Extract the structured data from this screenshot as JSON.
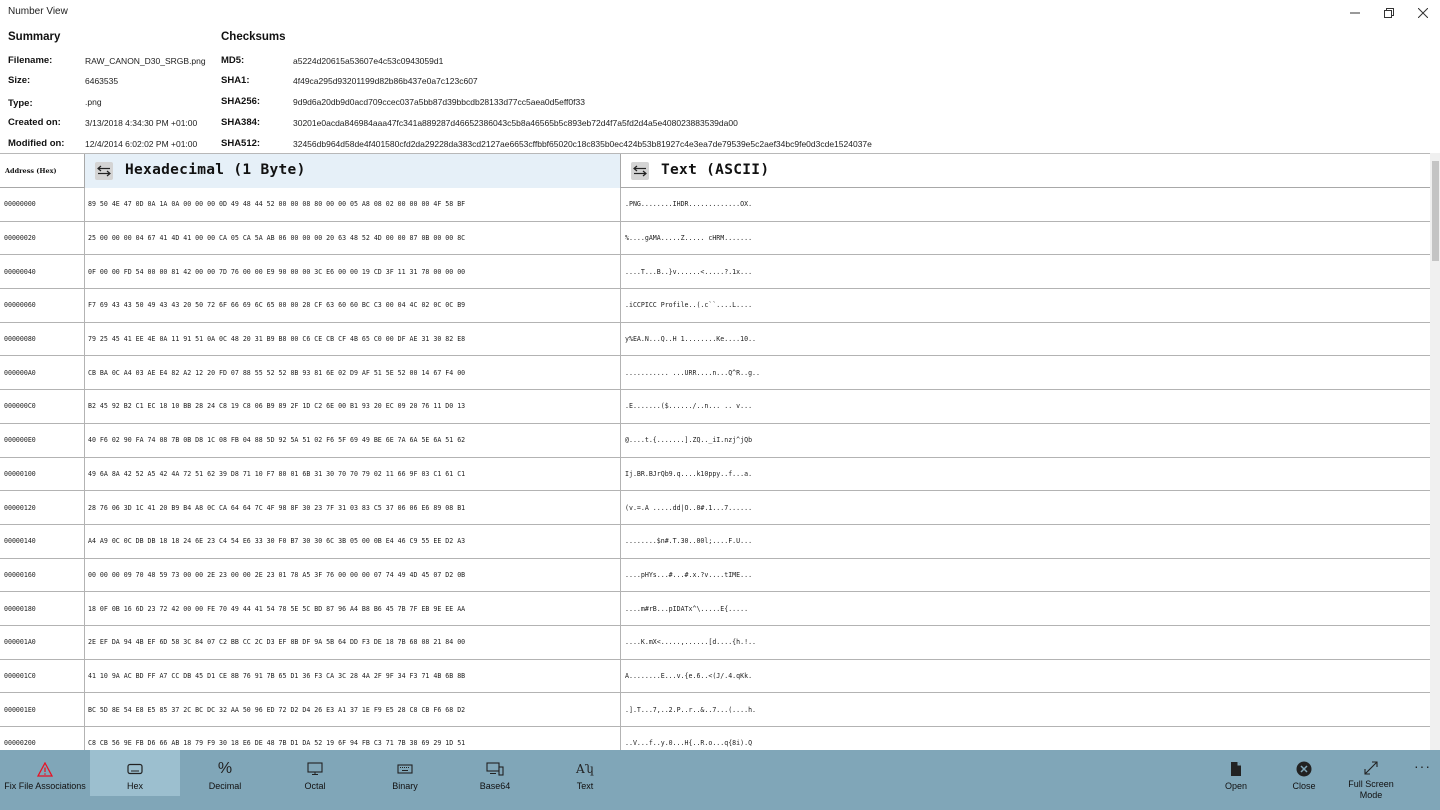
{
  "window": {
    "title": "Number View"
  },
  "summary": {
    "title": "Summary",
    "filename_label": "Filename:",
    "filename": "RAW_CANON_D30_SRGB.png",
    "size_label": "Size:",
    "size": "6463535",
    "type_label": "Type:",
    "type": ".png",
    "created_label": "Created on:",
    "created": "3/13/2018 4:34:30 PM +01:00",
    "modified_label": "Modified on:",
    "modified": "12/4/2014 6:02:02 PM +01:00"
  },
  "checksums": {
    "title": "Checksums",
    "md5_label": "MD5:",
    "md5": "a5224d20615a53607e4c53c0943059d1",
    "sha1_label": "SHA1:",
    "sha1": "4f49ca295d93201199d82b86b437e0a7c123c607",
    "sha256_label": "SHA256:",
    "sha256": "9d9d6a20db9d0acd709ccec037a5bb87d39bbcdb28133d77cc5aea0d5eff0f33",
    "sha384_label": "SHA384:",
    "sha384": "30201e0acda846984aaa47fc341a889287d46652386043c5b8a46565b5c893eb72d4f7a5fd2d4a5e408023883539da00",
    "sha512_label": "SHA512:",
    "sha512": "32456db964d58de4f401580cfd2da29228da383cd2127ae6653cffbbf65020c18c835b0ec424b53b81927c4e3ea7de79539e5c2aef34bc9fe0d3cde1524037e"
  },
  "grid": {
    "address_header": "Address (Hex)",
    "hex_header": "Hexadecimal (1 Byte)",
    "text_header": "Text (ASCII)",
    "rows": [
      {
        "addr": "00000000",
        "hex": "89 50 4E 47 0D 0A 1A 0A 00 00 00 0D 49 48 44 52 00 00 08 80 00 00 05 A8 08 02 00 00 00 4F 58 BF",
        "text": ".PNG........IHDR.............OX."
      },
      {
        "addr": "00000020",
        "hex": "25 00 00 00 04 67 41 4D 41 00 00 CA 05 CA 5A AB 06 00 00 00 20 63 48 52 4D 00 00 87 0B 00 00 8C",
        "text": "%....gAMA.....Z..... cHRM......."
      },
      {
        "addr": "00000040",
        "hex": "0F 00 00 FD 54 00 00 81 42 00 00 7D 76 00 00 E9 90 00 00 3C E6 00 00 19 CD 3F 11 31 78 00 00 00",
        "text": "....T...B..}v......<.....?.1x..."
      },
      {
        "addr": "00000060",
        "hex": "F7 69 43 43 50 49 43 43 20 50 72 6F 66 69 6C 65 00 00 28 CF 63 60 60 BC C3 00 04 4C 02 0C 0C B9",
        "text": ".iCCPICC Profile..(.c``....L...."
      },
      {
        "addr": "00000080",
        "hex": "79 25 45 41 EE 4E 0A 11 91 51 0A 0C 48 20 31 B9 B8 00 C6 CE CB CF 4B 65 C0 00 DF AE 31 30 82 E8",
        "text": "y%EA.N...Q..H 1........Ke....10.."
      },
      {
        "addr": "000000A0",
        "hex": "CB BA 0C A4 03 AE E4 82 A2 12 20 FD 07 88 55 52 52 8B 93 81 6E 02 D9 AF 51 5E 52 00 14 67 F4 00",
        "text": "........... ...URR....n...Q^R..g.."
      },
      {
        "addr": "000000C0",
        "hex": "B2 45 92 B2 C1 EC 18 10 BB 28 24 C8 19 C8 06 B9 89 2F 1D C2 6E 00 B1 93 20 EC 09 20 76 11 D0 13",
        "text": ".E.......($....../..n... .. v..."
      },
      {
        "addr": "000000E0",
        "hex": "40 F6 02 90 FA 74 08 7B 0B D8 1C 08 FB 04 88 5D 92 5A 51 02 F6 5F 69 49 BE 6E 7A 6A 5E 6A 51 62",
        "text": "@....t.{.......].ZQ.._iI.nzj^jQb"
      },
      {
        "addr": "00000100",
        "hex": "49 6A 8A 42 52 A5 42 4A 72 51 62 39 D8 71 10 F7 80 01 6B 31 30 70 70 79 02 11 66 9F 03 C1 61 C1",
        "text": "Ij.BR.BJrQb9.q....k10ppy..f...a."
      },
      {
        "addr": "00000120",
        "hex": "28 76 06 3D 1C 41 20 B9 B4 A8 0C CA 64 64 7C 4F 98 8F 30 23 7F 31 03 83 C5 37 06 06 E6 89 08 B1",
        "text": "(v.=.A .....dd|O..0#.1...7......"
      },
      {
        "addr": "00000140",
        "hex": "A4 A9 0C 0C DB DB 18 18 24 6E 23 C4 54 E6 33 30 F0 B7 30 30 6C 3B 05 00 0B E4 46 C9 55 EE D2 A3",
        "text": "........$n#.T.30..00l;....F.U..."
      },
      {
        "addr": "00000160",
        "hex": "00 00 00 09 70 48 59 73 00 00 2E 23 00 00 2E 23 01 78 A5 3F 76 00 00 00 07 74 49 4D 45 07 D2 0B",
        "text": "....pHYs...#...#.x.?v....tIME..."
      },
      {
        "addr": "00000180",
        "hex": "18 0F 0B 16 6D 23 72 42 00 00 FE 70 49 44 41 54 78 5E 5C BD 87 96 A4 B8 B6 45 7B 7F EB 9E EE AA",
        "text": "....m#rB...pIDATx^\\.....E{....."
      },
      {
        "addr": "000001A0",
        "hex": "2E EF DA 94 4B EF 6D 58 3C 84 07 C2 BB CC 2C D3 EF 8B DF 9A 5B 64 DD F3 DE 18 7B 68 08 21 84 00",
        "text": "....K.mX<.....,......[d....{h.!.."
      },
      {
        "addr": "000001C0",
        "hex": "41 10 9A AC BD FF A7 CC DB 45 D1 CE 8B 76 91 7B 65 D1 36 F3 CA 3C 28 4A 2F 9F 34 F3 71 4B 6B 8B",
        "text": "A........E...v.{e.6..<(J/.4.qKk."
      },
      {
        "addr": "000001E0",
        "hex": "BC 5D 8E 54 E8 E5 85 37 2C BC DC 32 AA 50 96 ED 72 D2 D4 26 E3 A1 37 1E F9 E5 28 C8 CB F6 68 D2",
        "text": ".].T...7,..2.P..r..&..7...(....h."
      },
      {
        "addr": "00000200",
        "hex": "C8 CB 56 9E FB D6 66 AB 18 79 F9 30 18 E6 DE 48 7B D1 DA 52 19 6F 94 FB C3 71 7B 38 69 29 1D 51",
        "text": "..V...f..y.0...H{..R.o...q{8i).Q"
      }
    ]
  },
  "commands": {
    "fix_assoc": "Fix File Associations",
    "hex": "Hex",
    "decimal": "Decimal",
    "octal": "Octal",
    "binary": "Binary",
    "base64": "Base64",
    "text": "Text",
    "open": "Open",
    "close": "Close",
    "fullscreen": "Full Screen Mode",
    "more": "···"
  },
  "colors": {
    "commandbar": "#80a6b8",
    "active_command": "#9cbfcf",
    "hex_header_bg": "#e6f0f8",
    "warning_icon": "#e81123"
  },
  "icons": {
    "fix_assoc": "warning-icon",
    "hex": "keyboard-icon",
    "decimal": "percent-icon",
    "octal": "monitor-icon",
    "binary": "keyboard-icon",
    "base64": "devices-icon",
    "text": "font-icon",
    "open": "file-icon",
    "close": "close-circle-icon",
    "fullscreen": "fullscreen-icon",
    "swap": "swap-arrows-icon"
  }
}
